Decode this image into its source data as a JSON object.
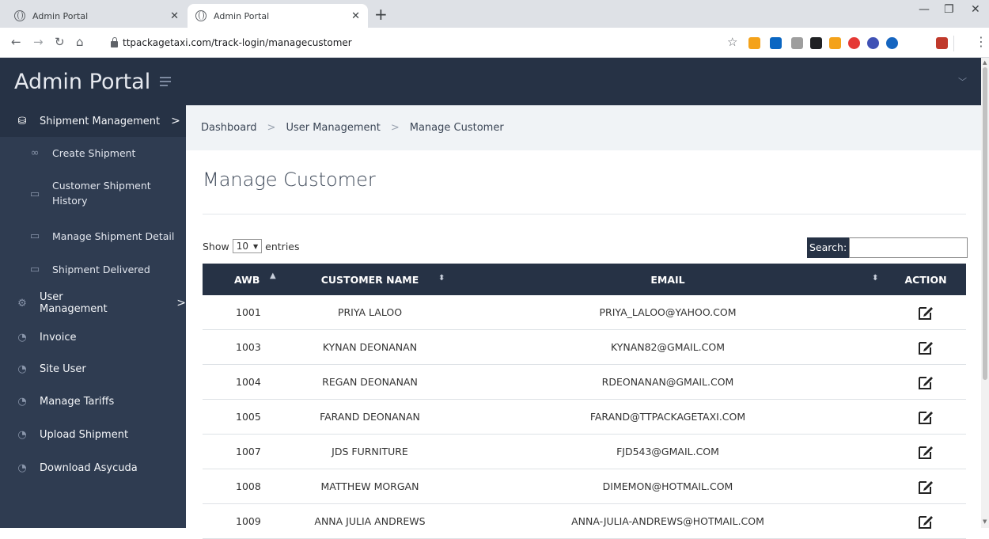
{
  "browser": {
    "tabs": [
      {
        "title": "Admin Portal"
      },
      {
        "title": "Admin Portal"
      }
    ],
    "url": "ttpackagetaxi.com/track-login/managecustomer",
    "extensions": [
      {
        "name": "rss-icon",
        "color": "#f4a21a"
      },
      {
        "name": "linkedin-icon",
        "color": "#0a66c2"
      },
      {
        "name": "g-icon",
        "color": "#9e9e9e"
      },
      {
        "name": "incognito-icon",
        "color": "#202124"
      },
      {
        "name": "feed-icon",
        "color": "#f4a21a"
      },
      {
        "name": "color-wheel-icon",
        "color": "#e53935"
      },
      {
        "name": "circle-icon",
        "color": "#3f51b5"
      },
      {
        "name": "globe-ext-icon",
        "color": "#1565c0"
      },
      {
        "name": "avatar-ext-icon",
        "color": "#c0392b"
      }
    ]
  },
  "app": {
    "brand": "Admin Portal",
    "sidebar": [
      {
        "label": "Shipment Management",
        "icon": "database-icon",
        "chevron": ">",
        "type": "main"
      },
      {
        "label": "Create Shipment",
        "icon": "infinity-icon",
        "type": "sub"
      },
      {
        "label": "Customer Shipment History",
        "icon": "monitor-icon",
        "type": "sub"
      },
      {
        "label": "Manage Shipment Detail",
        "icon": "card-icon",
        "type": "sub"
      },
      {
        "label": "Shipment Delivered",
        "icon": "card-icon",
        "type": "sub"
      },
      {
        "label": "User Management",
        "icon": "gear-icon",
        "chevron": ">",
        "type": "main"
      },
      {
        "label": "Invoice",
        "icon": "pie-icon",
        "type": "main"
      },
      {
        "label": "Site User",
        "icon": "pie-icon",
        "type": "main"
      },
      {
        "label": "Manage Tariffs",
        "icon": "pie-icon",
        "type": "main"
      },
      {
        "label": "Upload Shipment",
        "icon": "pie-icon",
        "type": "main"
      },
      {
        "label": "Download Asycuda",
        "icon": "pie-icon",
        "type": "main"
      }
    ],
    "breadcrumb": [
      "Dashboard",
      "User Management",
      "Manage Customer"
    ],
    "page_title": "Manage Customer",
    "entries": {
      "show": "Show",
      "value": "10",
      "suffix": "entries"
    },
    "search": {
      "label": "Search:",
      "value": ""
    },
    "table": {
      "columns": [
        "AWB",
        "CUSTOMER NAME",
        "EMAIL",
        "ACTION"
      ],
      "rows": [
        {
          "awb": "1001",
          "name": "PRIYA LALOO",
          "email": "PRIYA_LALOO@YAHOO.COM"
        },
        {
          "awb": "1003",
          "name": "KYNAN DEONANAN",
          "email": "KYNAN82@GMAIL.COM"
        },
        {
          "awb": "1004",
          "name": "REGAN DEONANAN",
          "email": "RDEONANAN@GMAIL.COM"
        },
        {
          "awb": "1005",
          "name": "FARAND DEONANAN",
          "email": "FARAND@TTPACKAGETAXI.COM"
        },
        {
          "awb": "1007",
          "name": "JDS FURNITURE",
          "email": "FJD543@GMAIL.COM"
        },
        {
          "awb": "1008",
          "name": "MATTHEW MORGAN",
          "email": "DIMEMON@HOTMAIL.COM"
        },
        {
          "awb": "1009",
          "name": "ANNA JULIA ANDREWS",
          "email": "ANNA-JULIA-ANDREWS@HOTMAIL.COM"
        }
      ]
    }
  }
}
